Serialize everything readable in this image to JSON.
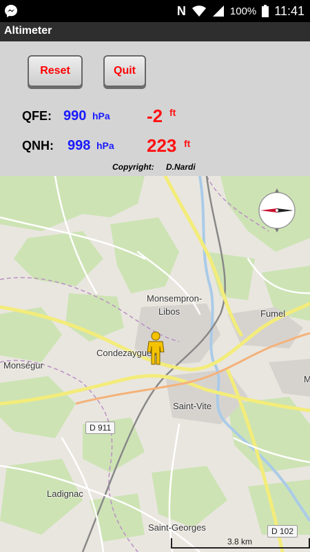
{
  "app": {
    "title": "Altimeter"
  },
  "status_bar": {
    "battery": "100%",
    "time": "11:41",
    "carrier_letter": "N"
  },
  "buttons": {
    "reset": "Reset",
    "quit": "Quit"
  },
  "readings": {
    "qfe": {
      "label": "QFE:",
      "value": "990",
      "unit": "hPa",
      "altitude": "-2",
      "altitude_unit": "ft"
    },
    "qnh": {
      "label": "QNH:",
      "value": "998",
      "unit": "hPa",
      "altitude": "223",
      "altitude_unit": "ft"
    }
  },
  "copyright": {
    "label": "Copyright:",
    "author": "D.Nardi"
  },
  "map": {
    "places": [
      "Monsempron-",
      "Libos",
      "Fumel",
      "Condezaygues",
      "Monségur",
      "Saint-Vite",
      "Ladignac",
      "Saint-Georges",
      "M"
    ],
    "road_signs": [
      "D 911",
      "D 102"
    ],
    "scale": "3.8 km"
  },
  "colors": {
    "value_blue": "#1a1aff",
    "altitude_red": "#ff1111",
    "panel_bg": "#d4d4d4"
  }
}
